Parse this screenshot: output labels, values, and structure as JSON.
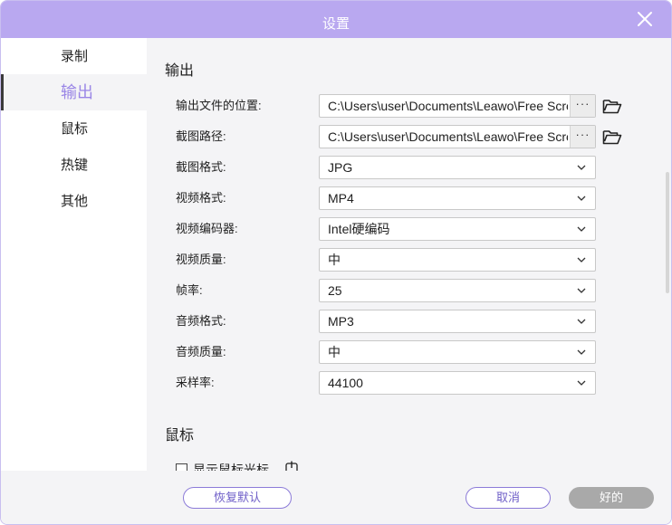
{
  "window": {
    "title": "设置"
  },
  "sidebar": {
    "items": [
      {
        "label": "录制",
        "active": false
      },
      {
        "label": "输出",
        "active": true
      },
      {
        "label": "鼠标",
        "active": false
      },
      {
        "label": "热键",
        "active": false
      },
      {
        "label": "其他",
        "active": false
      }
    ]
  },
  "output": {
    "section_title": "输出",
    "rows": [
      {
        "label": "输出文件的位置:",
        "value": "C:\\Users\\user\\Documents\\Leawo\\Free Screen Recorder",
        "type": "path",
        "more": "···"
      },
      {
        "label": "截图路径:",
        "value": "C:\\Users\\user\\Documents\\Leawo\\Free Screen Recorder",
        "type": "path",
        "more": "···"
      },
      {
        "label": "截图格式:",
        "value": "JPG",
        "type": "select"
      },
      {
        "label": "视频格式:",
        "value": "MP4",
        "type": "select"
      },
      {
        "label": "视频编码器:",
        "value": "Intel硬编码",
        "type": "select"
      },
      {
        "label": "视频质量:",
        "value": "中",
        "type": "select"
      },
      {
        "label": "帧率:",
        "value": "25",
        "type": "select"
      },
      {
        "label": "音频格式:",
        "value": "MP3",
        "type": "select"
      },
      {
        "label": "音频质量:",
        "value": "中",
        "type": "select"
      },
      {
        "label": "采样率:",
        "value": "44100",
        "type": "select"
      }
    ]
  },
  "mouse": {
    "section_title": "鼠标",
    "show_cursor_label": "显示鼠标光标",
    "show_cursor_checked": false
  },
  "footer": {
    "reset_label": "恢复默认",
    "cancel_label": "取消",
    "ok_label": "好的"
  },
  "colors": {
    "titlebar": "#b9a8f0",
    "accent": "#9a86e6",
    "button_border": "#8c7bd8",
    "disabled": "#a9a9a9"
  }
}
